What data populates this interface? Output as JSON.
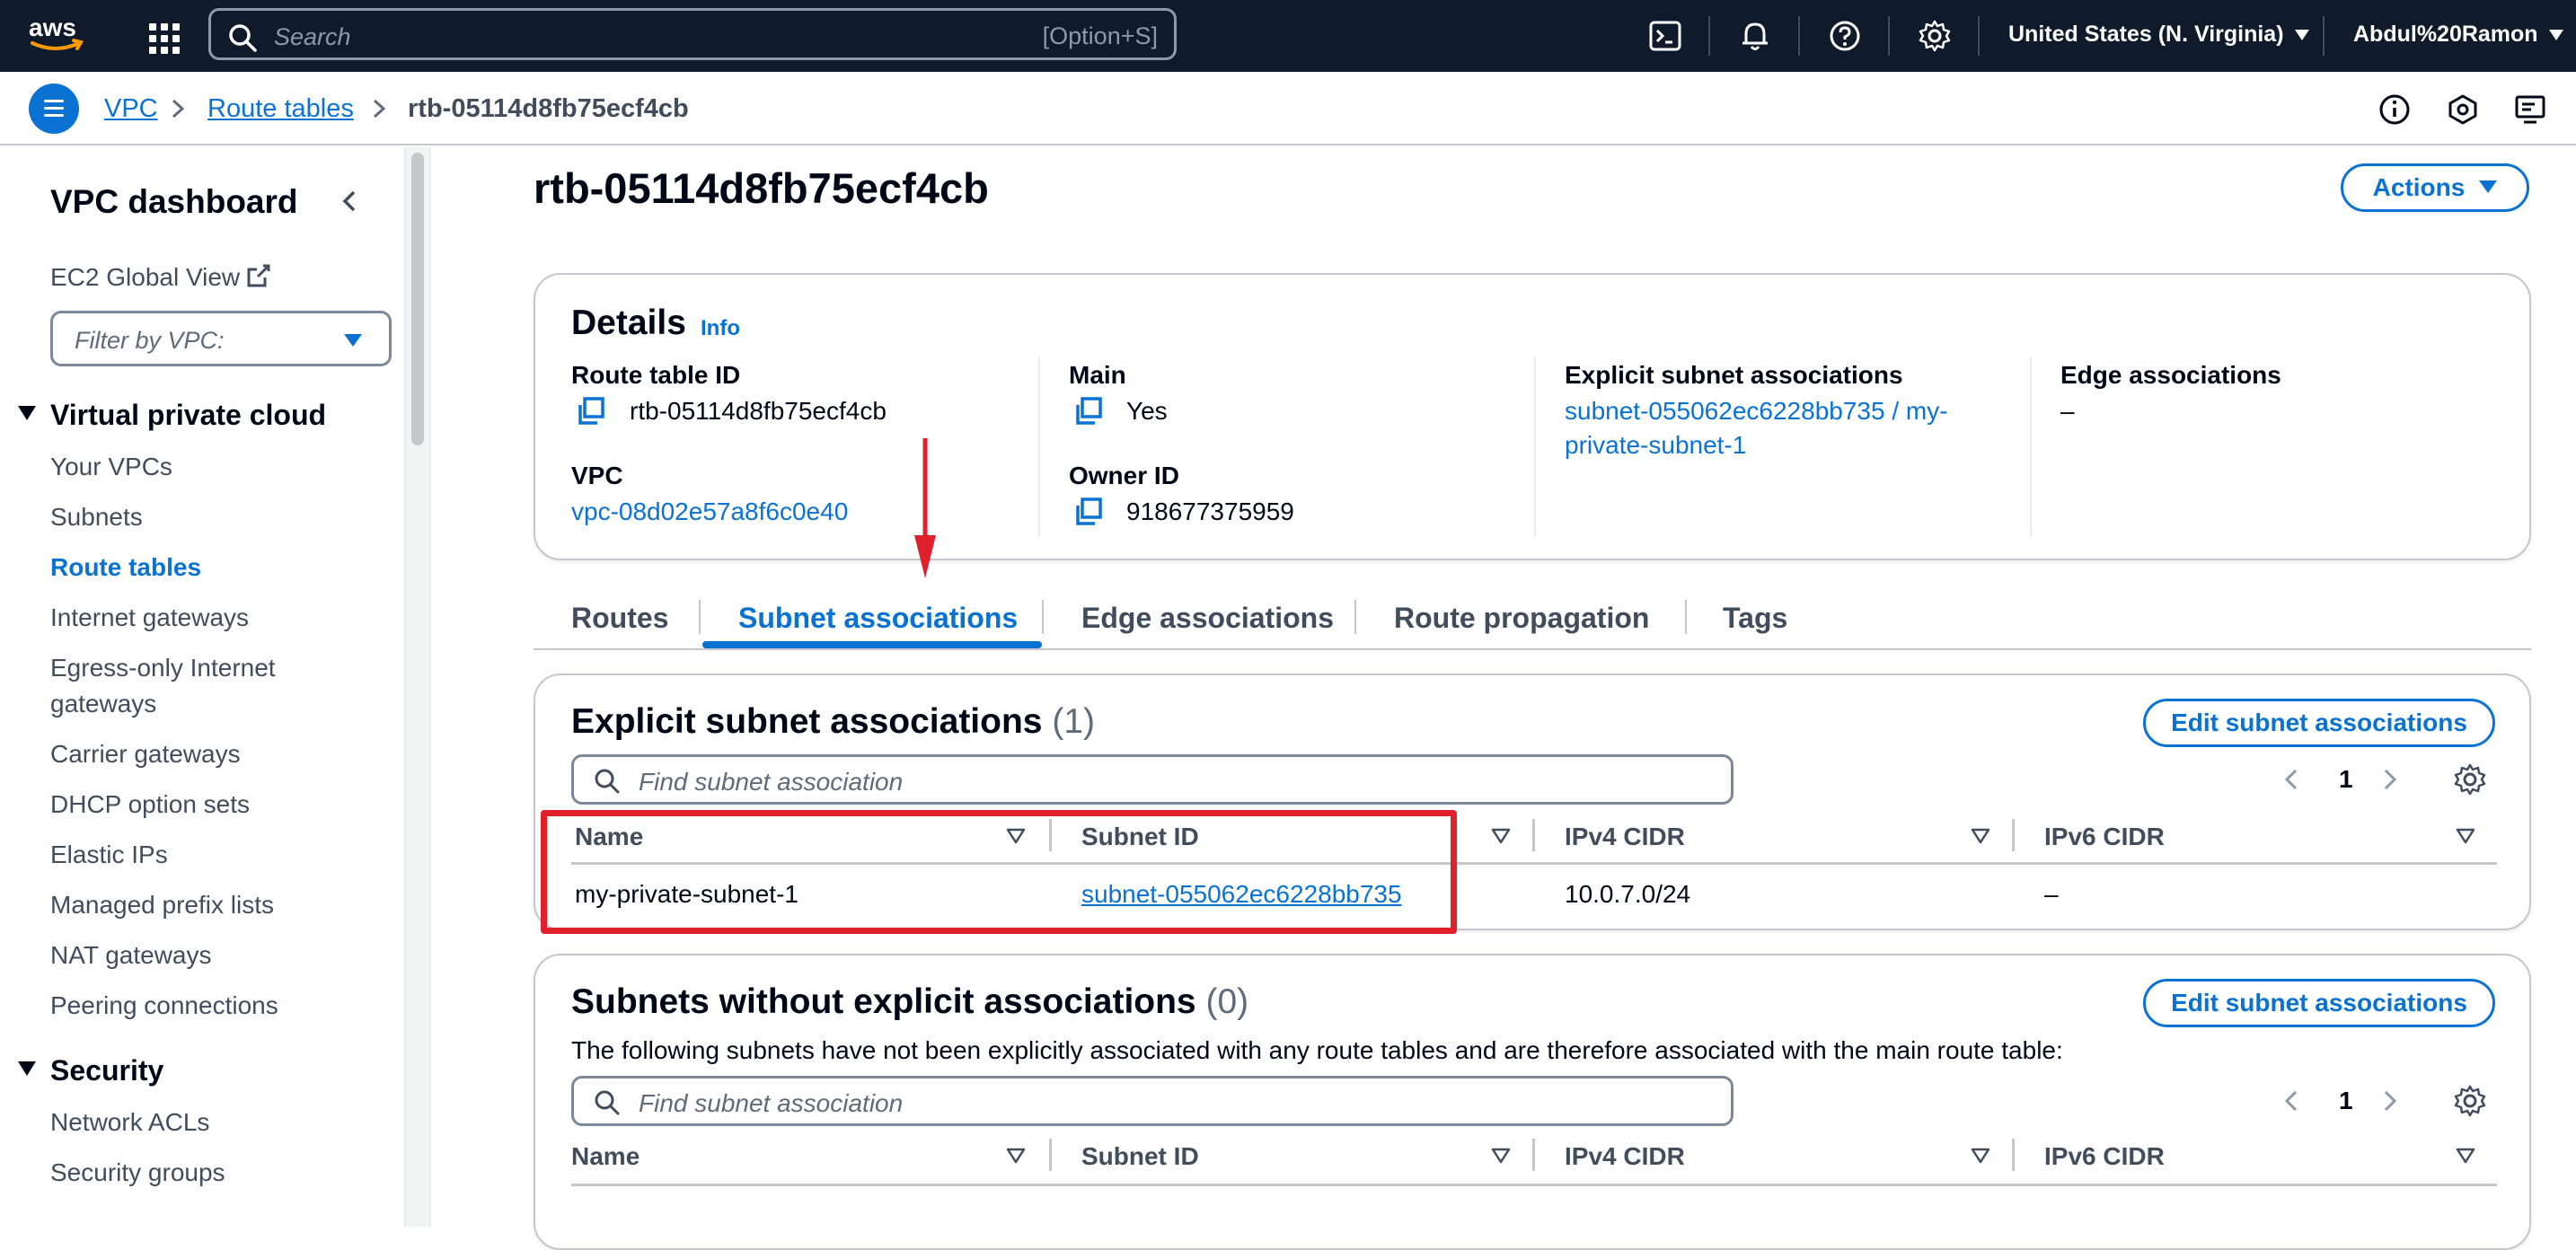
{
  "topnav": {
    "logo_text": "aws",
    "search_placeholder": "Search",
    "search_shortcut": "[Option+S]",
    "region": "United States (N. Virginia)",
    "account": "Abdul%20Ramon",
    "icons": [
      "cloudshell-icon",
      "bell-icon",
      "help-icon",
      "settings-icon"
    ]
  },
  "breadcrumb": {
    "items": [
      "VPC",
      "Route tables"
    ],
    "current": "rtb-05114d8fb75ecf4cb"
  },
  "sidebar": {
    "title": "VPC dashboard",
    "ec2_global_view": "EC2 Global View",
    "filter_placeholder": "Filter by VPC:",
    "sections": [
      {
        "title": "Virtual private cloud",
        "items": [
          "Your VPCs",
          "Subnets",
          "Route tables",
          "Internet gateways",
          "Egress-only Internet",
          "gateways",
          "Carrier gateways",
          "DHCP option sets",
          "Elastic IPs",
          "Managed prefix lists",
          "NAT gateways",
          "Peering connections"
        ]
      },
      {
        "title": "Security",
        "items": [
          "Network ACLs",
          "Security groups"
        ]
      }
    ],
    "active_item": "Route tables"
  },
  "page": {
    "title": "rtb-05114d8fb75ecf4cb",
    "actions_label": "Actions"
  },
  "details": {
    "heading": "Details",
    "info": "Info",
    "route_table_id_label": "Route table ID",
    "route_table_id": "rtb-05114d8fb75ecf4cb",
    "vpc_label": "VPC",
    "vpc": "vpc-08d02e57a8f6c0e40",
    "main_label": "Main",
    "main": "Yes",
    "owner_label": "Owner ID",
    "owner": "918677375959",
    "explicit_label": "Explicit subnet associations",
    "explicit_line1": "subnet-055062ec6228bb735 / my-",
    "explicit_line2": "private-subnet-1",
    "edge_label": "Edge associations",
    "edge": "–"
  },
  "tabs": [
    "Routes",
    "Subnet associations",
    "Edge associations",
    "Route propagation",
    "Tags"
  ],
  "active_tab": "Subnet associations",
  "explicit": {
    "heading": "Explicit subnet associations",
    "count": "(1)",
    "edit_label": "Edit subnet associations",
    "filter_placeholder": "Find subnet association",
    "page": "1",
    "columns": [
      "Name",
      "Subnet ID",
      "IPv4 CIDR",
      "IPv6 CIDR"
    ],
    "rows": [
      {
        "name": "my-private-subnet-1",
        "subnet_id": "subnet-055062ec6228bb735",
        "ipv4": "10.0.7.0/24",
        "ipv6": "–"
      }
    ]
  },
  "without": {
    "heading": "Subnets without explicit associations",
    "count": "(0)",
    "edit_label": "Edit subnet associations",
    "description": "The following subnets have not been explicitly associated with any route tables and are therefore associated with the main route table:",
    "filter_placeholder": "Find subnet association",
    "page": "1",
    "columns": [
      "Name",
      "Subnet ID",
      "IPv4 CIDR",
      "IPv6 CIDR"
    ]
  },
  "colors": {
    "nav_bg": "#0f1b2a",
    "link": "#0972d3",
    "annotation": "#e0202a"
  }
}
